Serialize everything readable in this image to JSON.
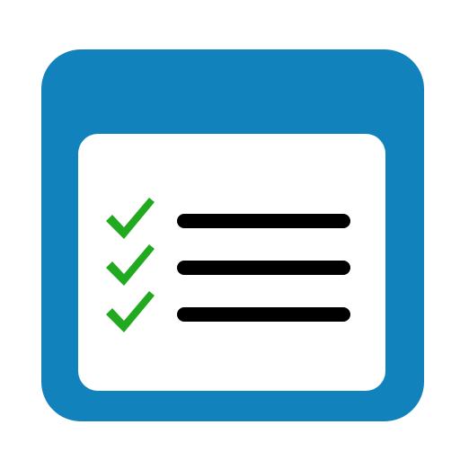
{
  "icon": {
    "name": "checklist-window-icon",
    "colors": {
      "frame": "#1182bc",
      "panel": "#ffffff",
      "check": "#21a920",
      "line": "#000000"
    },
    "items": [
      {
        "icon": "checkmark-icon",
        "checked": true
      },
      {
        "icon": "checkmark-icon",
        "checked": true
      },
      {
        "icon": "checkmark-icon",
        "checked": true
      }
    ]
  }
}
